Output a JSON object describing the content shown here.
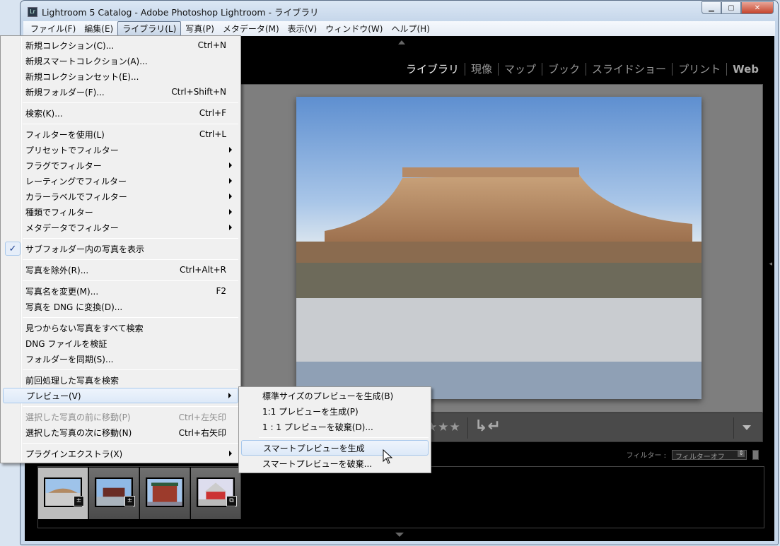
{
  "window": {
    "title": "Lightroom 5 Catalog - Adobe Photoshop Lightroom - ライブラリ",
    "app_icon": "Lr",
    "controls": [
      "minimize",
      "maximize",
      "close"
    ]
  },
  "menubar": [
    "ファイル(F)",
    "編集(E)",
    "ライブラリ(L)",
    "写真(P)",
    "メタデータ(M)",
    "表示(V)",
    "ウィンドウ(W)",
    "ヘルプ(H)"
  ],
  "modules": {
    "items": [
      "ライブラリ",
      "現像",
      "マップ",
      "ブック",
      "スライドショー",
      "プリント",
      "Web"
    ],
    "active": "ライブラリ"
  },
  "library_menu": {
    "items": [
      {
        "label": "新規コレクション(C)...",
        "shortcut": "Ctrl+N"
      },
      {
        "label": "新規スマートコレクション(A)..."
      },
      {
        "label": "新規コレクションセット(E)..."
      },
      {
        "label": "新規フォルダー(F)...",
        "shortcut": "Ctrl+Shift+N"
      },
      {
        "label": "検索(K)...",
        "shortcut": "Ctrl+F"
      },
      {
        "label": "フィルターを使用(L)",
        "shortcut": "Ctrl+L"
      },
      {
        "label": "プリセットでフィルター",
        "submenu": true
      },
      {
        "label": "フラグでフィルター",
        "submenu": true
      },
      {
        "label": "レーティングでフィルター",
        "submenu": true
      },
      {
        "label": "カラーラベルでフィルター",
        "submenu": true
      },
      {
        "label": "種類でフィルター",
        "submenu": true
      },
      {
        "label": "メタデータでフィルター",
        "submenu": true
      },
      {
        "label": "サブフォルダー内の写真を表示",
        "checked": true
      },
      {
        "label": "写真を除外(R)...",
        "shortcut": "Ctrl+Alt+R"
      },
      {
        "label": "写真名を変更(M)...",
        "shortcut": "F2"
      },
      {
        "label": "写真を DNG に変換(D)..."
      },
      {
        "label": "見つからない写真をすべて検索"
      },
      {
        "label": "DNG ファイルを検証"
      },
      {
        "label": "フォルダーを同期(S)..."
      },
      {
        "label": "前回処理した写真を検索"
      },
      {
        "label": "プレビュー(V)",
        "submenu": true,
        "highlighted": true
      },
      {
        "label": "選択した写真の前に移動(P)",
        "shortcut": "Ctrl+左矢印",
        "disabled": true
      },
      {
        "label": "選択した写真の次に移動(N)",
        "shortcut": "Ctrl+右矢印"
      },
      {
        "label": "プラグインエクストラ(X)",
        "submenu": true
      }
    ]
  },
  "preview_submenu": {
    "items": [
      {
        "label": "標準サイズのプレビューを生成(B)"
      },
      {
        "label": "1:1 プレビューを生成(P)"
      },
      {
        "label": "1 : 1 プレビューを破棄(D)..."
      },
      {
        "label": "スマートプレビューを生成",
        "highlighted": true
      },
      {
        "label": "スマートプレビューを破棄..."
      }
    ]
  },
  "toolbar": {
    "stars": "★★★",
    "rotate_left": "rotate-left-icon",
    "rotate_right": "rotate-right-icon"
  },
  "filmstrip": {
    "filter_label": "フィルター :",
    "filter_value": "フィルターオフ",
    "thumbnails": [
      {
        "selected": true,
        "badge": "edit-adjust-icon"
      },
      {
        "badge": "edit-adjust-icon"
      },
      {},
      {
        "badge": "smart-preview-icon"
      }
    ]
  }
}
